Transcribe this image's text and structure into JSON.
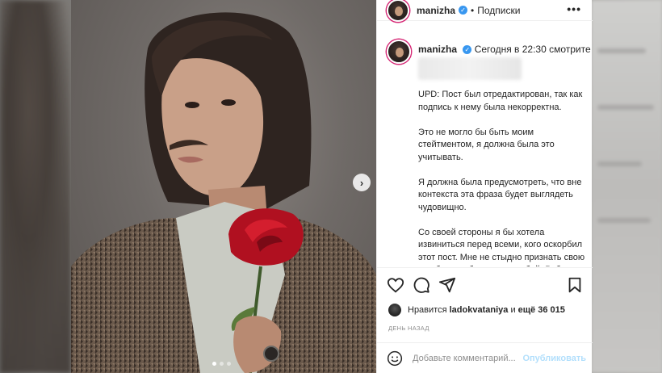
{
  "post": {
    "username": "manizha",
    "verified": true,
    "separator": "•",
    "follow_label": "Подписки",
    "more_label": "•••"
  },
  "caption": {
    "username": "manizha",
    "first_line": "Сегодня в 22:30 смотрите",
    "paragraphs": [
      "UPD: Пост был отредактирован, так как подпись к нему была некорректна.",
      "Это не могло бы быть моим стейтментом, я должна была это учитывать.",
      "Я должна была предусмотреть, что вне контекста эта фраза будет выглядеть чудовищно.",
      "Со своей стороны я бы хотела извиниться перед всеми, кого оскорбил этот пост. Мне не стыдно признать свою ошибку и работать над собой. Ребята, простите"
    ]
  },
  "actions": {
    "like_icon": "heart-icon",
    "comment_icon": "comment-icon",
    "share_icon": "share-icon",
    "save_icon": "bookmark-icon"
  },
  "likes": {
    "prefix": "Нравится",
    "user": "ladokvataniya",
    "middle": "и",
    "count_text": "ещё 36 015"
  },
  "timestamp": "ДЕНЬ НАЗАД",
  "comment_box": {
    "emoji_icon": "emoji-icon",
    "placeholder": "Добавьте комментарий...",
    "publish_label": "Опубликовать"
  },
  "carousel": {
    "next_icon": "chevron-right-icon",
    "slide_count": 3,
    "active_index": 0
  },
  "colors": {
    "link_disabled": "#b2dffc",
    "verified": "#3897f0",
    "text": "#262626",
    "muted": "#8e8e8e"
  }
}
